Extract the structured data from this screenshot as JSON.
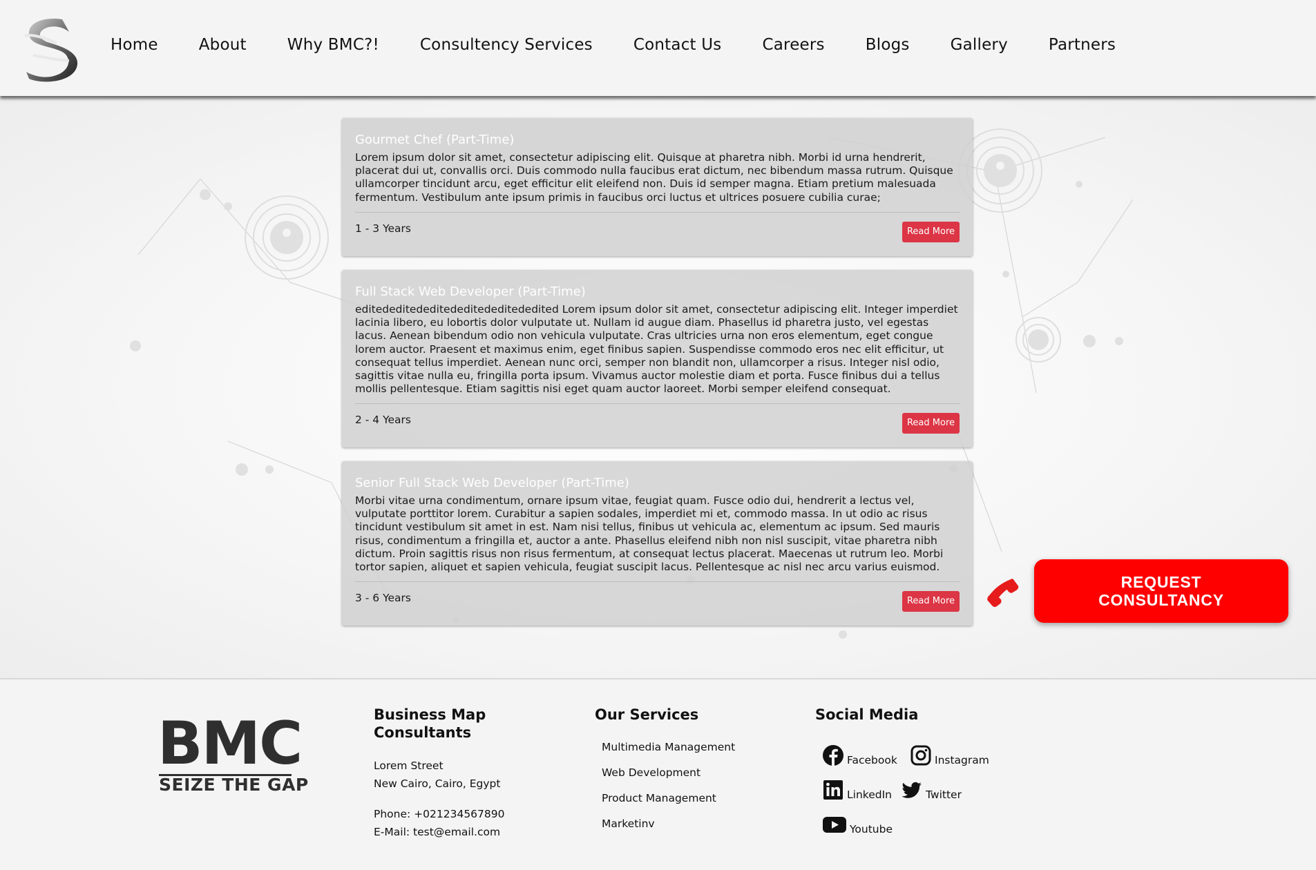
{
  "nav": {
    "items": [
      "Home",
      "About",
      "Why BMC?!",
      "Consultency Services",
      "Contact Us",
      "Careers",
      "Blogs",
      "Gallery",
      "Partners"
    ]
  },
  "jobs": [
    {
      "title": "Gourmet Chef (Part-Time)",
      "description": "Lorem ipsum dolor sit amet, consectetur adipiscing elit. Quisque at pharetra nibh. Morbi id urna hendrerit, placerat dui ut, convallis orci. Duis commodo nulla faucibus erat dictum, nec bibendum massa rutrum. Quisque ullamcorper tincidunt arcu, eget efficitur elit eleifend non. Duis id semper magna. Etiam pretium malesuada fermentum. Vestibulum ante ipsum primis in faucibus orci luctus et ultrices posuere cubilia curae;",
      "experience": "1 - 3 Years",
      "button": "Read More"
    },
    {
      "title": "Full Stack Web Developer (Part-Time)",
      "description": "editededitededitededitededitededited Lorem ipsum dolor sit amet, consectetur adipiscing elit. Integer imperdiet lacinia libero, eu lobortis dolor vulputate ut. Nullam id augue diam. Phasellus id pharetra justo, vel egestas lacus. Aenean bibendum odio non vehicula vulputate. Cras ultricies urna non eros elementum, eget congue lorem auctor. Praesent et maximus enim, eget finibus sapien. Suspendisse commodo eros nec elit efficitur, ut consequat tellus imperdiet. Aenean nunc orci, semper non blandit non, ullamcorper a risus. Integer nisl odio, sagittis vitae nulla eu, fringilla porta ipsum. Vivamus auctor molestie diam et porta. Fusce finibus dui a tellus mollis pellentesque. Etiam sagittis nisi eget quam auctor laoreet. Morbi semper eleifend consequat.",
      "experience": "2 - 4 Years",
      "button": "Read More"
    },
    {
      "title": "Senior Full Stack Web Developer (Part-Time)",
      "description": "Morbi vitae urna condimentum, ornare ipsum vitae, feugiat quam. Fusce odio dui, hendrerit a lectus vel, vulputate porttitor lorem. Curabitur a sapien sodales, imperdiet mi et, commodo massa. In ut odio ac risus tincidunt vestibulum sit amet in est. Nam nisi tellus, finibus ut vehicula ac, elementum ac ipsum. Sed mauris risus, condimentum a fringilla et, auctor a ante. Phasellus eleifend nibh non nisl suscipit, vitae pharetra nibh dictum. Proin sagittis risus non risus fermentum, at consequat lectus placerat. Maecenas ut rutrum leo. Morbi tortor sapien, aliquet et sapien vehicula, feugiat suscipit lacus. Pellentesque ac nisl nec arcu varius euismod.",
      "experience": "3 - 6 Years",
      "button": "Read More"
    }
  ],
  "consult": {
    "line1": "REQUEST",
    "line2": "CONSULTANCY",
    "color": "#ff0000"
  },
  "footer": {
    "logo": {
      "big": "BMC",
      "tagline": "SEIZE THE GAP"
    },
    "business": {
      "title_line1": "Business Map",
      "title_line2": "Consultants",
      "street": "Lorem Street",
      "city": "New Cairo, Cairo, Egypt",
      "phone": "Phone: +021234567890",
      "email": "E-Mail: test@email.com"
    },
    "services": {
      "title": "Our Services",
      "items": [
        "Multimedia Management",
        "Web Development",
        "Product Management",
        "Marketinv"
      ]
    },
    "social": {
      "title": "Social Media",
      "facebook": "Facebook",
      "instagram": "Instagram",
      "linkedin": "LinkedIn",
      "twitter": "Twitter",
      "youtube": "Youtube"
    }
  },
  "colors": {
    "accent_red": "#dc3545",
    "consult_red": "#ff0000"
  }
}
